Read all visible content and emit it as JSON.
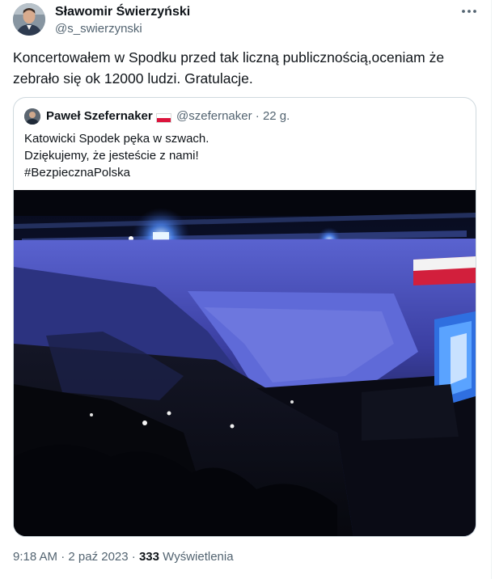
{
  "tweet": {
    "display_name": "Sławomir Świerzyński",
    "handle": "@s_swierzynski",
    "text_line1": "Koncertowałem w Spodku przed tak liczną publicznością,oceniam że",
    "text_line2": "zebrało się ok 12000 ludzi. Gratulacje.",
    "time": "9:18 AM",
    "date": "2 paź 2023",
    "views": "333",
    "views_label": "Wyświetlenia",
    "separator": "·"
  },
  "quote": {
    "display_name": "Paweł Szefernaker",
    "handle": "@szefernaker",
    "age": "· 22 g.",
    "lines": [
      "Katowicki Spodek pęka w szwach.",
      "Dziękujemy, że jesteście z nami!",
      "#BezpiecznaPolska"
    ]
  },
  "icons": {
    "more": "more-dots-icon",
    "flag": "poland-flag-icon"
  },
  "colors": {
    "text_primary": "#0f1419",
    "text_secondary": "#536471",
    "border": "#cfd9de",
    "flag_red": "#dc143c"
  }
}
